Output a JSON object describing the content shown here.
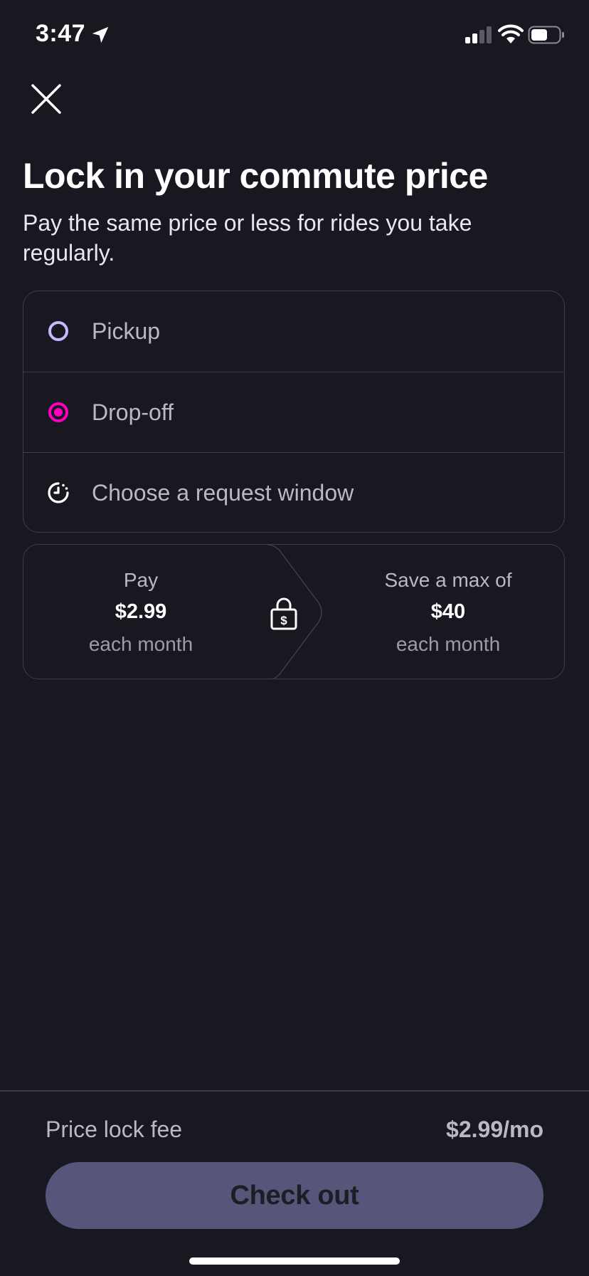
{
  "status_bar": {
    "time": "3:47",
    "icons": [
      "location-arrow-icon",
      "cellular-signal-icon",
      "wifi-icon",
      "battery-icon"
    ]
  },
  "header": {
    "close_icon": "close-icon",
    "title": "Lock in your commute price",
    "subtitle": "Pay the same price or less for rides you take regularly."
  },
  "trip_options": [
    {
      "label": "Pickup",
      "icon": "pickup-circle-icon",
      "color": "#c9b7ff"
    },
    {
      "label": "Drop-off",
      "icon": "dropoff-target-icon",
      "color": "#ff00bf"
    },
    {
      "label": "Choose a request window",
      "icon": "clock-icon",
      "color": "#ffffff"
    }
  ],
  "price_summary": {
    "pay": {
      "label": "Pay",
      "amount": "$2.99",
      "period": "each month"
    },
    "save": {
      "label": "Save a max of",
      "amount": "$40",
      "period": "each month"
    },
    "icon": "price-lock-icon"
  },
  "footer": {
    "fee_label": "Price lock fee",
    "fee_value": "$2.99/mo",
    "checkout_label": "Check out"
  },
  "colors": {
    "background": "#181920",
    "border": "#3c3d47",
    "button": "#57557a",
    "accent_pink": "#ff00bf",
    "accent_lavender": "#c9b7ff"
  }
}
